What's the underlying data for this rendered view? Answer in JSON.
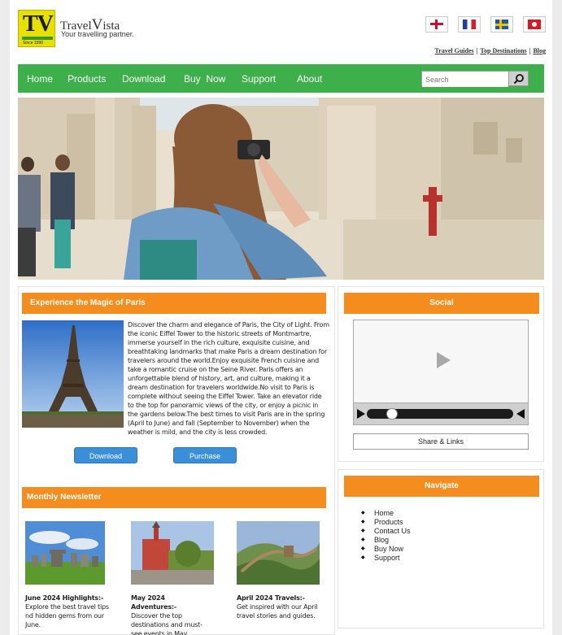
{
  "header": {
    "logo_letters": "TV",
    "logo_since": "Since 1990",
    "brand_travel": "Travel",
    "brand_v": "V",
    "brand_ista": "ista",
    "tagline": "Your travelling partner."
  },
  "flags": [
    "england-flag-icon",
    "france-flag-icon",
    "sweden-flag-icon",
    "turkey-flag-icon"
  ],
  "toplinks": [
    "Travel Guides",
    "Top Destinations",
    "Blog"
  ],
  "nav": {
    "items": [
      "Home",
      "Products",
      "Download",
      "Buy  Now",
      "Support",
      "About"
    ],
    "search_placeholder": "Search",
    "color": "#3db04c"
  },
  "paris": {
    "heading": "Experience the Magic of Paris",
    "description": "Discover the charm and elegance of Paris, the City of Light. From the iconic Eiffel Tower to the historic streets of Montmartre, immerse yourself in the rich culture, exquisite cuisine, and breathtaking landmarks that make Paris a dream destination for travelers around the world.Enjoy exquisite French cuisine and take a romantic cruise on the Seine River. Paris offers an unforgettable blend of history, art, and culture, making it a dream destination for travelers worldwide.No visit to Paris is complete without seeing the Eiffel Tower. Take an elevator ride to the top for panoramic views of the city, or enjoy a picnic in the gardens below.The best times to visit Paris are in the spring (April to June) and fall (September to November) when the weather is mild, and the city is less crowded.",
    "download_label": "Download",
    "purchase_label": "Purchase"
  },
  "newsletter": {
    "heading": "Monthly Newsletter",
    "items": [
      {
        "title": "June 2024 Highlights:-",
        "text": "Explore the best travel tips nd hidden gems from our June."
      },
      {
        "title": "May 2024 Adventures:-",
        "text": "Discover the top destinations and must-see events in May."
      },
      {
        "title": "April 2024 Travels:-",
        "text": "Get inspired with our April travel stories and guides."
      }
    ]
  },
  "social": {
    "heading": "Social",
    "share_label": "Share & Links"
  },
  "navigate": {
    "heading": "Navigate",
    "links": [
      "Home",
      "Products",
      "Contact Us",
      "Blog",
      "Buy Now",
      "Support"
    ]
  },
  "colors": {
    "accent_orange": "#f48c1e",
    "button_blue": "#3a8fd8",
    "logo_yellow": "#e8e000"
  }
}
